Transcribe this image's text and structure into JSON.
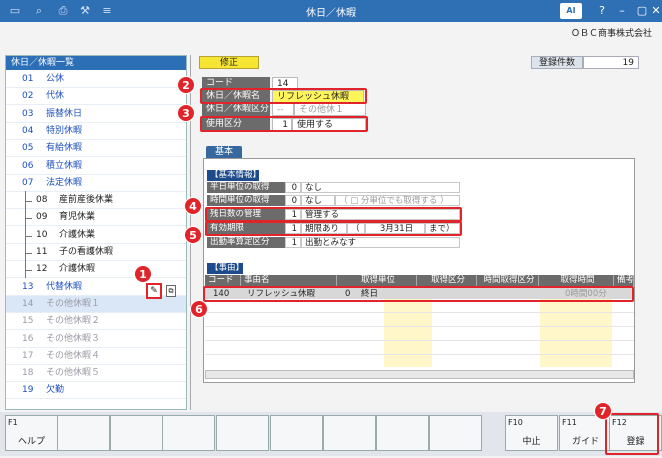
{
  "window": {
    "title": "休日／休暇",
    "logo": "AI"
  },
  "company": "ＯＢＣ商事株式会社",
  "list": {
    "header": "休日／休暇一覧",
    "items": [
      {
        "num": "01",
        "name": "公休",
        "style": "blue"
      },
      {
        "num": "02",
        "name": "代休",
        "style": "blue"
      },
      {
        "num": "03",
        "name": "振替休日",
        "style": "blue"
      },
      {
        "num": "04",
        "name": "特別休暇",
        "style": "blue"
      },
      {
        "num": "05",
        "name": "有給休暇",
        "style": "blue"
      },
      {
        "num": "06",
        "name": "積立休暇",
        "style": "blue"
      },
      {
        "num": "07",
        "name": "法定休暇",
        "style": "blue"
      },
      {
        "num": "08",
        "name": "産前産後休業",
        "style": "child"
      },
      {
        "num": "09",
        "name": "育児休業",
        "style": "child"
      },
      {
        "num": "10",
        "name": "介護休業",
        "style": "child"
      },
      {
        "num": "11",
        "name": "子の看護休暇",
        "style": "child"
      },
      {
        "num": "12",
        "name": "介護休暇",
        "style": "child"
      },
      {
        "num": "13",
        "name": "代替休暇",
        "style": "blue"
      },
      {
        "num": "14",
        "name": "その他休暇１",
        "style": "grey"
      },
      {
        "num": "15",
        "name": "その他休暇２",
        "style": "grey"
      },
      {
        "num": "16",
        "name": "その他休暇３",
        "style": "grey"
      },
      {
        "num": "17",
        "name": "その他休暇４",
        "style": "grey"
      },
      {
        "num": "18",
        "name": "その他休暇５",
        "style": "grey"
      },
      {
        "num": "19",
        "name": "欠勤",
        "style": "blue"
      }
    ]
  },
  "header": {
    "edit_tab": "修正",
    "reg_count_label": "登録件数",
    "reg_count": "19"
  },
  "form": {
    "code_label": "コード",
    "code": "14",
    "name_label": "休日／休暇名",
    "name": "リフレッシュ休暇",
    "class_label": "休日／休暇区分",
    "class_code": "--",
    "class_name": "その他休１",
    "use_label": "使用区分",
    "use_code": "1",
    "use_name": "使用する"
  },
  "tab": "基本",
  "basic": {
    "section": "【基本情報】",
    "rows": [
      {
        "label": "半日単位の取得",
        "code": "0",
        "value": "なし"
      },
      {
        "label": "時間単位の取得",
        "code": "0",
        "value": "なし",
        "extra": "（ □ 分単位でも取得する ）"
      },
      {
        "label": "残日数の管理",
        "code": "1",
        "value": "管理する"
      },
      {
        "label": "有効期限",
        "code": "1",
        "value": "期限あり",
        "date_open": "（",
        "date": "3月31日",
        "date_close": "まで）"
      },
      {
        "label": "出勤率算定区分",
        "code": "1",
        "value": "出勤とみなす"
      }
    ]
  },
  "reasons": {
    "section": "【事由】",
    "columns": [
      "コード",
      "事由名",
      "取得単位",
      "取得区分",
      "時間取得区分",
      "取得時間",
      "備考"
    ],
    "rows": [
      {
        "code": "140",
        "name": "リフレッシュ休暇",
        "unit_code": "0",
        "unit": "終日",
        "time": "0時間00分"
      }
    ]
  },
  "fkeys": [
    {
      "key": "F1",
      "label": "ヘルプ"
    },
    {
      "key": "",
      "label": ""
    },
    {
      "key": "",
      "label": ""
    },
    {
      "key": "",
      "label": ""
    },
    {
      "key": "",
      "label": ""
    },
    {
      "key": "",
      "label": ""
    },
    {
      "key": "",
      "label": ""
    },
    {
      "key": "",
      "label": ""
    },
    {
      "key": "",
      "label": ""
    },
    {
      "key": "F10",
      "label": "中止"
    },
    {
      "key": "F11",
      "label": "ガイド"
    },
    {
      "key": "F12",
      "label": "登録"
    }
  ],
  "badges": [
    "1",
    "2",
    "3",
    "4",
    "5",
    "6",
    "7"
  ],
  "colors": {
    "accent": "#2f6fb4",
    "highlight": "#e0242a",
    "edit_tab": "#f6e533"
  }
}
